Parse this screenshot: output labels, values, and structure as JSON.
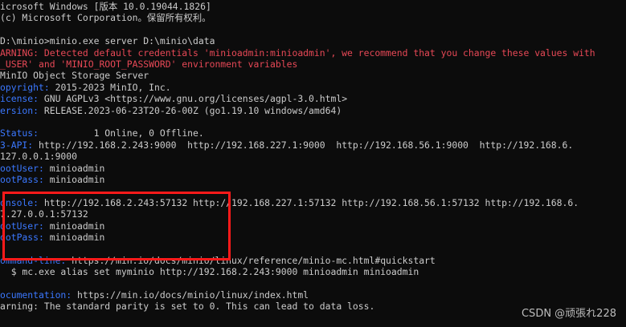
{
  "colors": {
    "background": "#0c0c0c",
    "text": "#cccccc",
    "warning": "#e74856",
    "label": "#3b78ff",
    "highlight": "#ff1a1a"
  },
  "terminal": {
    "lines": [
      [
        {
          "t": "icrosoft Windows [版本 10.0.19044.1826]",
          "c": "white"
        }
      ],
      [
        {
          "t": "(c) Microsoft Corporation。保留所有权利。",
          "c": "white"
        }
      ],
      [],
      [
        {
          "t": "D:\\minio>minio.exe server D:\\minio\\data",
          "c": "white"
        }
      ],
      [
        {
          "t": "ARNING: Detected default credentials 'minioadmin:minioadmin', we recommend that you change these values with",
          "c": "red"
        }
      ],
      [
        {
          "t": "_USER' and 'MINIO_ROOT_PASSWORD' environment variables",
          "c": "red"
        }
      ],
      [
        {
          "t": "MinIO Object Storage Server",
          "c": "white"
        }
      ],
      [
        {
          "t": "opyright:",
          "c": "blue"
        },
        {
          "t": " 2015-2023 MinIO, Inc.",
          "c": "white"
        }
      ],
      [
        {
          "t": "icense:",
          "c": "blue"
        },
        {
          "t": " GNU AGPLv3 <https://www.gnu.org/licenses/agpl-3.0.html>",
          "c": "white"
        }
      ],
      [
        {
          "t": "ersion:",
          "c": "blue"
        },
        {
          "t": " RELEASE.2023-06-23T20-26-00Z (go1.19.10 windows/amd64)",
          "c": "white"
        }
      ],
      [],
      [
        {
          "t": "Status:",
          "c": "blue"
        },
        {
          "t": "          1 Online, 0 Offline.",
          "c": "white"
        }
      ],
      [
        {
          "t": "3-API:",
          "c": "blue"
        },
        {
          "t": " http://192.168.2.243:9000  http://192.168.227.1:9000  http://192.168.56.1:9000  http://192.168.6.",
          "c": "white"
        }
      ],
      [
        {
          "t": "127.0.0.1:9000",
          "c": "white"
        }
      ],
      [
        {
          "t": "ootUser:",
          "c": "blue"
        },
        {
          "t": " minioadmin",
          "c": "white"
        }
      ],
      [
        {
          "t": "ootPass:",
          "c": "blue"
        },
        {
          "t": " minioadmin",
          "c": "white"
        }
      ],
      [],
      [
        {
          "t": "onsole:",
          "c": "blue"
        },
        {
          "t": " http://192.168.2.243:57132 http://192.168.227.1:57132 http://192.168.56.1:57132 http://192.168.6.",
          "c": "white"
        }
      ],
      [
        {
          "t": "7.27.0.0.1:57132",
          "c": "white"
        }
      ],
      [
        {
          "t": "ootUser:",
          "c": "blue"
        },
        {
          "t": " minioadmin",
          "c": "white"
        }
      ],
      [
        {
          "t": "ootPass:",
          "c": "blue"
        },
        {
          "t": " minioadmin",
          "c": "white"
        }
      ],
      [],
      [
        {
          "t": "ommand-line:",
          "c": "blue"
        },
        {
          "t": " https://min.io/docs/minio/linux/reference/minio-mc.html#quickstart",
          "c": "white"
        }
      ],
      [
        {
          "t": "  $ mc.exe alias set myminio http://192.168.2.243:9000 minioadmin minioadmin",
          "c": "white"
        }
      ],
      [],
      [
        {
          "t": "ocumentation:",
          "c": "blue"
        },
        {
          "t": " https://min.io/docs/minio/linux/index.html",
          "c": "white"
        }
      ],
      [
        {
          "t": "arning: The standard parity is set to 0. This can lead to data loss.",
          "c": "white"
        }
      ]
    ]
  },
  "watermark": "CSDN @顽張れ228"
}
